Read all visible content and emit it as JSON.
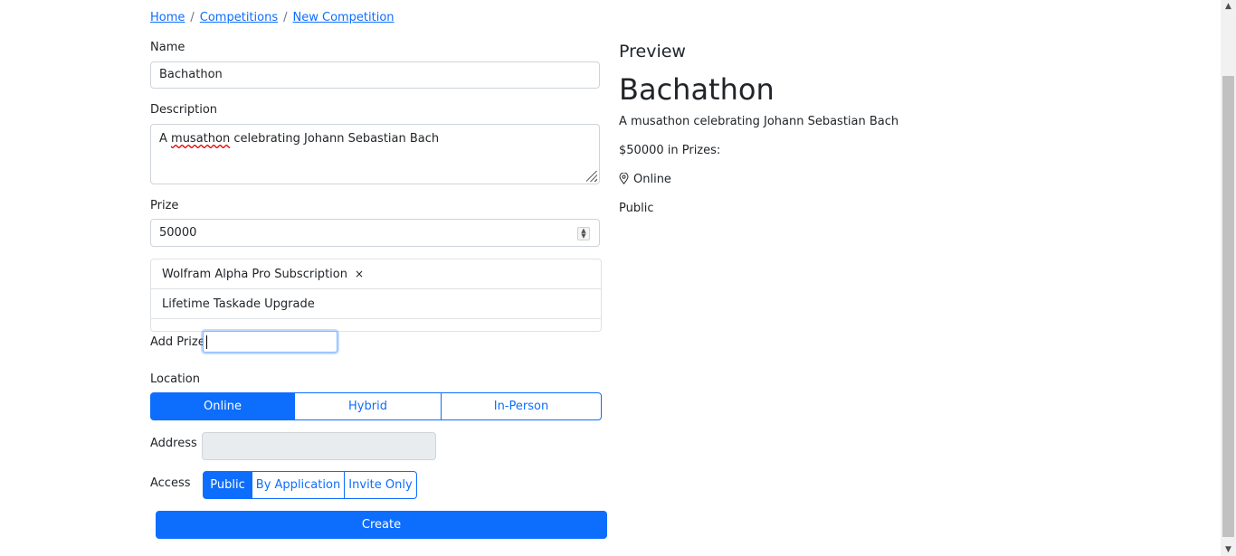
{
  "breadcrumb": {
    "home": "Home",
    "competitions": "Competitions",
    "current": "New Competition",
    "separator": "/"
  },
  "form": {
    "name_label": "Name",
    "name_value": "Bachathon",
    "description_label": "Description",
    "description_value_pre": "A ",
    "description_value_misspelled": "musathon",
    "description_value_post": " celebrating Johann Sebastian Bach",
    "prize_label": "Prize",
    "prize_value": "50000",
    "prize_items": [
      {
        "label": "Wolfram Alpha Pro Subscription",
        "remove": "×"
      },
      {
        "label": "Lifetime Taskade Upgrade"
      }
    ],
    "add_prize_label": "Add Prize",
    "location_label": "Location",
    "location_options": [
      "Online",
      "Hybrid",
      "In-Person"
    ],
    "location_selected": "Online",
    "address_label": "Address",
    "access_label": "Access",
    "access_options": [
      "Public",
      "By Application",
      "Invite Only"
    ],
    "access_selected": "Public",
    "create_label": "Create"
  },
  "preview": {
    "heading": "Preview",
    "title": "Bachathon",
    "description": "A musathon celebrating Johann Sebastian Bach",
    "prizes_text": "$50000 in Prizes:",
    "location_icon": "map-pin-icon",
    "location": "Online",
    "access": "Public"
  },
  "colors": {
    "primary": "#0d6efd",
    "disabled_bg": "#e9ecef",
    "border": "#ced4da"
  }
}
